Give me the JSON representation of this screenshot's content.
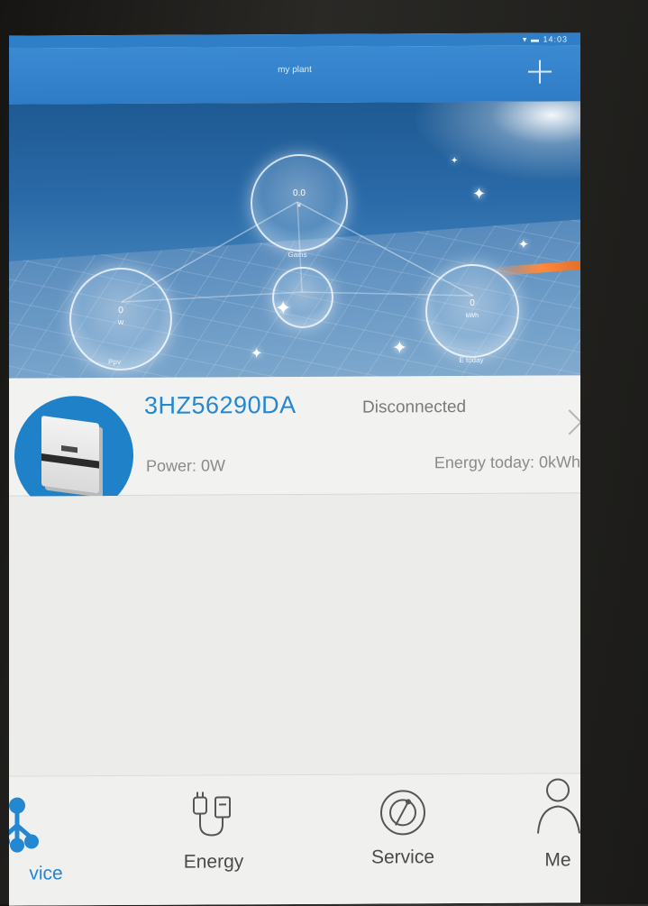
{
  "status_bar": {
    "time": "14:03"
  },
  "app_bar": {
    "title": "my plant"
  },
  "hero": {
    "gain": {
      "value": "0.0",
      "unit": "¥",
      "label": "Gains"
    },
    "ppv": {
      "value": "0",
      "unit": "W",
      "label": "Ppv"
    },
    "etoday": {
      "value": "0",
      "unit": "kWh",
      "label": "E today"
    }
  },
  "device": {
    "serial": "3HZ56290DA",
    "status": "Disconnected",
    "power": "Power: 0W",
    "energy_today": "Energy today: 0kWh"
  },
  "bottom_nav": {
    "items": [
      {
        "label": "Device",
        "visible_label": "vice"
      },
      {
        "label": "Energy"
      },
      {
        "label": "Service"
      },
      {
        "label": "Me"
      }
    ]
  },
  "colors": {
    "accent": "#2487d1",
    "app_bar": "#2f7cc6",
    "text_muted": "#8a8a8a"
  }
}
